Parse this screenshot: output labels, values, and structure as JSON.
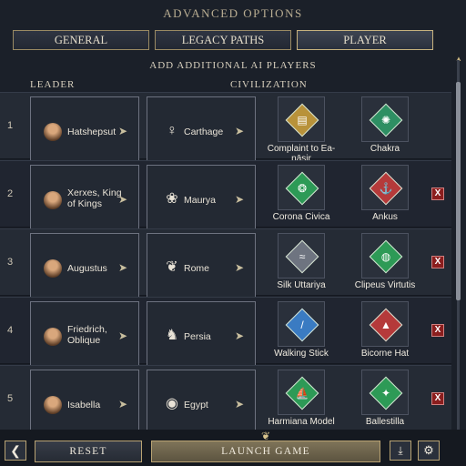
{
  "header": {
    "title": "ADVANCED OPTIONS"
  },
  "tabs": [
    {
      "label": "GENERAL",
      "active": false
    },
    {
      "label": "LEGACY PATHS",
      "active": false
    },
    {
      "label": "PLAYER",
      "active": true
    }
  ],
  "subtitle": "ADD ADDITIONAL AI PLAYERS",
  "columns": {
    "leader": "LEADER",
    "civilization": "CIVILIZATION"
  },
  "players": [
    {
      "num": "1",
      "leader": "Hatshepsut",
      "civ": "Carthage",
      "civ_icon": "carthage-tanit-icon",
      "mementos": [
        {
          "label": "Complaint to Ea-nāsir",
          "color": "#b8923a",
          "icon": "tablet-icon"
        },
        {
          "label": "Chakra",
          "color": "#2e8f63",
          "icon": "wheel-icon"
        }
      ],
      "removable": false
    },
    {
      "num": "2",
      "leader": "Xerxes, King of Kings",
      "civ": "Maurya",
      "civ_icon": "lotus-icon",
      "mementos": [
        {
          "label": "Corona Civica",
          "color": "#2d9a56",
          "icon": "wreath-icon"
        },
        {
          "label": "Ankus",
          "color": "#b53a3a",
          "icon": "hook-icon"
        }
      ],
      "removable": true
    },
    {
      "num": "3",
      "leader": "Augustus",
      "civ": "Rome",
      "civ_icon": "laurel-icon",
      "mementos": [
        {
          "label": "Silk Uttariya",
          "color": "#6e7480",
          "icon": "scarf-icon"
        },
        {
          "label": "Clipeus Virtutis",
          "color": "#2d9a56",
          "icon": "shield-icon"
        }
      ],
      "removable": true
    },
    {
      "num": "4",
      "leader": "Friedrich, Oblique",
      "civ": "Persia",
      "civ_icon": "lion-icon",
      "mementos": [
        {
          "label": "Walking Stick",
          "color": "#3a7bc2",
          "icon": "stick-icon"
        },
        {
          "label": "Bicorne Hat",
          "color": "#b53a3a",
          "icon": "hat-icon"
        }
      ],
      "removable": true
    },
    {
      "num": "5",
      "leader": "Isabella",
      "civ": "Egypt",
      "civ_icon": "eye-of-horus-icon",
      "mementos": [
        {
          "label": "Harmiana Model",
          "color": "#2d9a56",
          "icon": "ship-icon"
        },
        {
          "label": "Ballestilla",
          "color": "#2d9a56",
          "icon": "instrument-icon"
        }
      ],
      "removable": true
    }
  ],
  "remove_label": "X",
  "cursor_glyph": "➤",
  "footer": {
    "back_glyph": "❮",
    "reset_label": "RESET",
    "launch_label": "LAUNCH GAME",
    "download_glyph": "⤓",
    "settings_glyph": "⚙"
  }
}
